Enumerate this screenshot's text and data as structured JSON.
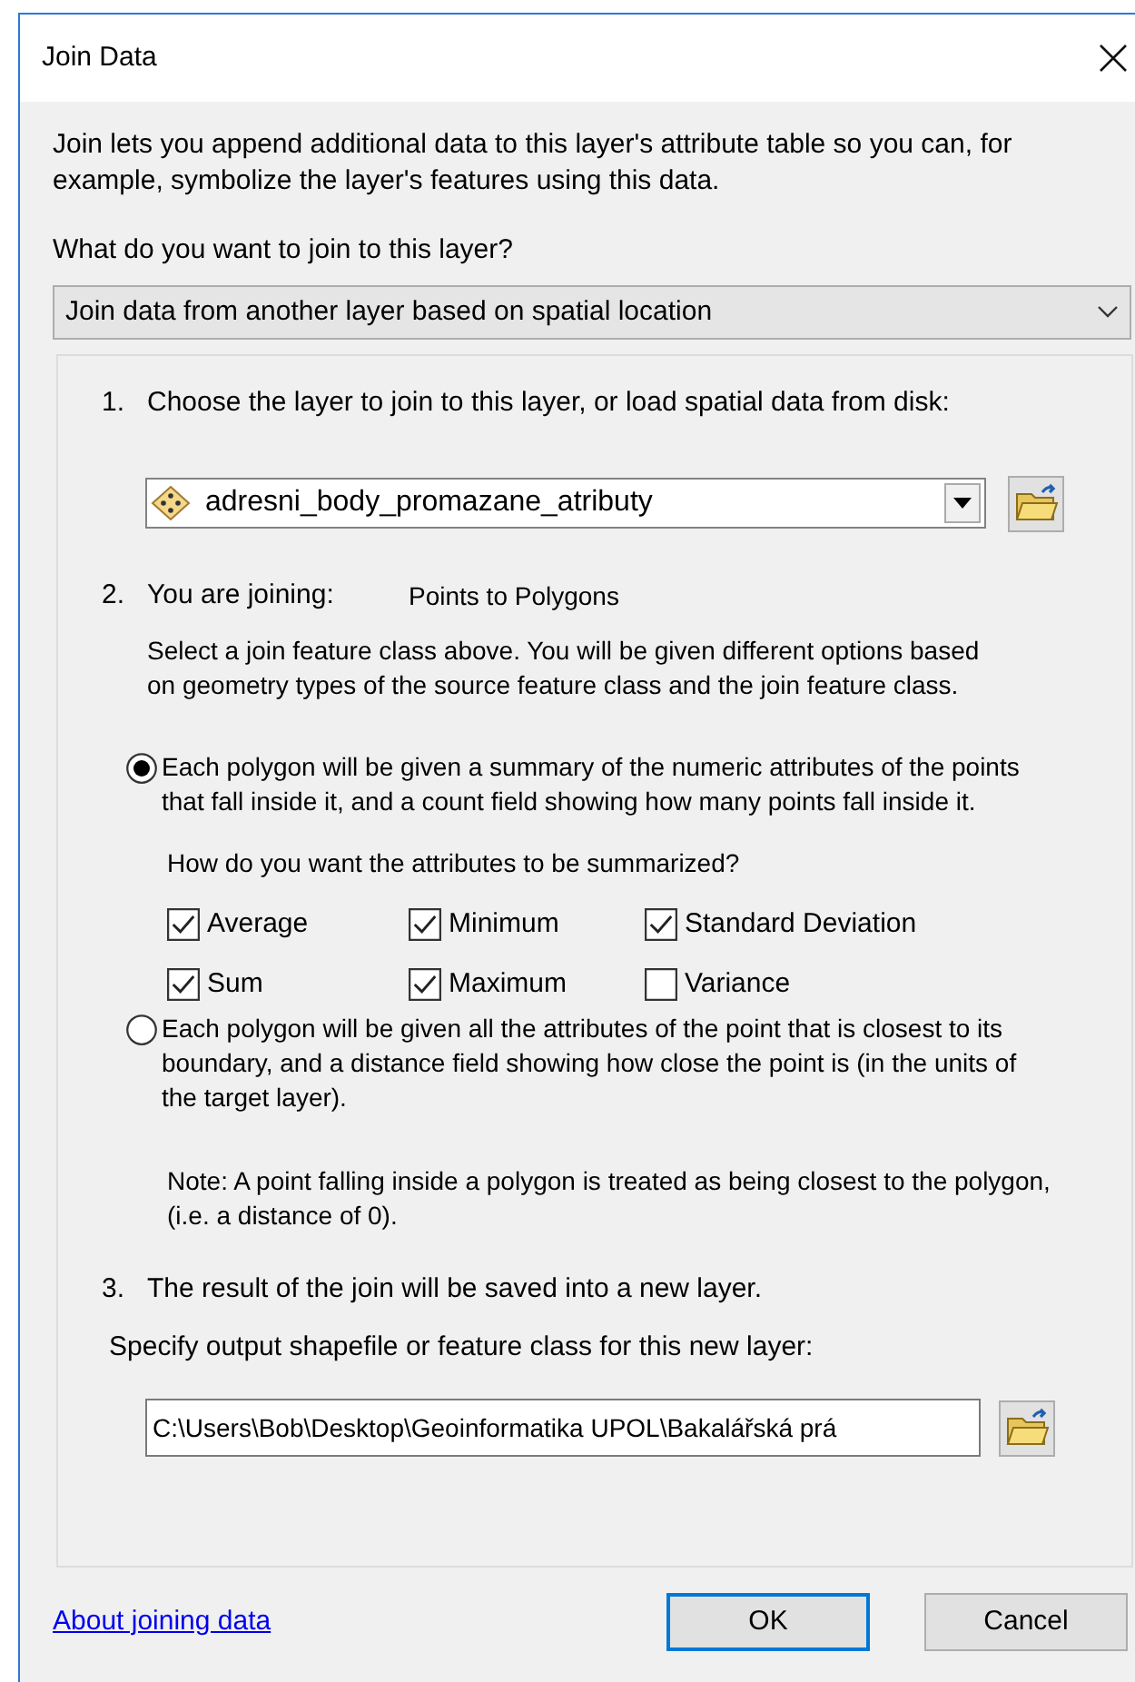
{
  "window": {
    "title": "Join Data"
  },
  "intro": "Join lets you append additional data to this layer's attribute table so you can, for example, symbolize the layer's features using this data.",
  "question": "What do you want to join to this layer?",
  "join_type": {
    "value": "Join data from another layer based on spatial location"
  },
  "step_1": {
    "number": "1.",
    "label": "Choose the layer to join to this layer, or load spatial data from disk:",
    "layer": {
      "value": "adresni_body_promazane_atributy"
    }
  },
  "step_2": {
    "number": "2.",
    "label": "You are joining:",
    "join_kind": "Points to Polygons",
    "description": "Select a join feature class above.  You will be given different options based on geometry types of the source feature class and the join feature class.",
    "options": [
      {
        "text": "Each polygon will be given a summary of the numeric attributes of the points that fall inside it, and a count field showing how many points fall inside it.",
        "selected": true
      },
      {
        "text": "Each polygon will be given all the attributes of the point that is closest to its boundary, and a distance field showing how close the point is (in the units of the target layer).",
        "selected": false
      }
    ],
    "summary_question": "How do you want the attributes to be summarized?",
    "statistics": [
      {
        "label": "Average",
        "checked": true
      },
      {
        "label": "Minimum",
        "checked": true
      },
      {
        "label": "Standard Deviation",
        "checked": true
      },
      {
        "label": "Sum",
        "checked": true
      },
      {
        "label": "Maximum",
        "checked": true
      },
      {
        "label": "Variance",
        "checked": false
      }
    ],
    "note": "Note: A point falling inside a polygon is treated as being closest to the polygon, (i.e. a distance of 0)."
  },
  "step_3": {
    "number": "3.",
    "label": "The result of the join will be saved into a new layer.",
    "output_prompt": "Specify output shapefile or feature class for this new layer:",
    "output_path": {
      "value": "C:\\Users\\Bob\\Desktop\\Geoinformatika UPOL\\Bakalářská prá"
    }
  },
  "help_link": "About joining data",
  "buttons": [
    {
      "label": "OK",
      "default": true
    },
    {
      "label": "Cancel",
      "default": false
    }
  ]
}
